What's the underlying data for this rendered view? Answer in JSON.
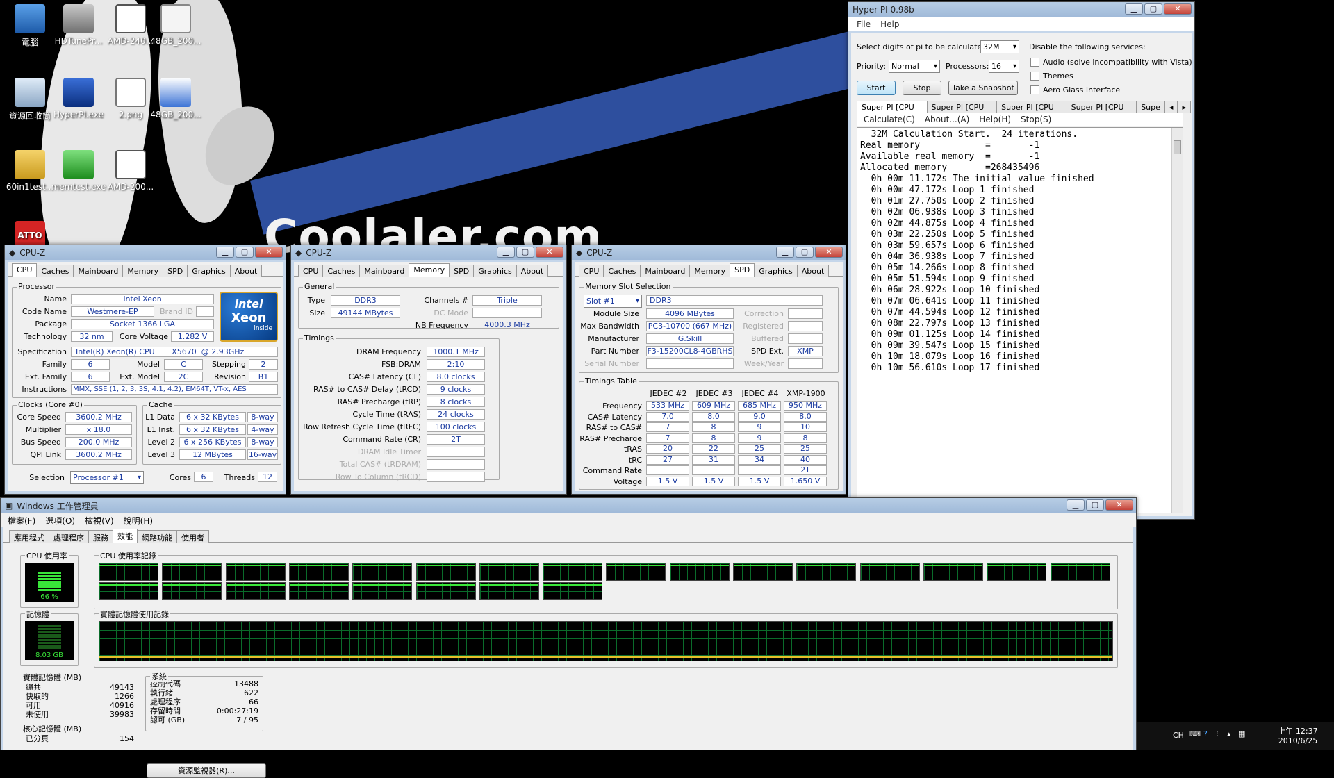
{
  "desktop": {
    "wallpaper_text": "Coolaler.com",
    "icons": [
      {
        "label": "電腦"
      },
      {
        "label": "HDTunePr..."
      },
      {
        "label": "AMD-240..."
      },
      {
        "label": "48GB_200..."
      },
      {
        "label": "資源回收筒"
      },
      {
        "label": "HyperPI.exe"
      },
      {
        "label": "2.png"
      },
      {
        "label": "48GB_200..."
      },
      {
        "label": "60in1test..."
      },
      {
        "label": "memtest.exe"
      },
      {
        "label": "AMD-200..."
      },
      {
        "label": "ATTO"
      },
      {
        "label": ""
      },
      {
        "label": ""
      }
    ]
  },
  "cpuz1": {
    "title": "CPU-Z",
    "tabs": [
      "CPU",
      "Caches",
      "Mainboard",
      "Memory",
      "SPD",
      "Graphics",
      "About"
    ],
    "processor": {
      "group": "Processor",
      "name_l": "Name",
      "name": "Intel Xeon",
      "codename_l": "Code Name",
      "codename": "Westmere-EP",
      "brandid_l": "Brand ID",
      "package_l": "Package",
      "package": "Socket 1366 LGA",
      "tech_l": "Technology",
      "tech": "32 nm",
      "voltage_l": "Core Voltage",
      "voltage": "1.282 V",
      "spec_l": "Specification",
      "spec": "Intel(R) Xeon(R) CPU",
      "spec2": "X5670",
      "spec3": "@ 2.93GHz",
      "family_l": "Family",
      "family": "6",
      "model_l": "Model",
      "model": "C",
      "stepping_l": "Stepping",
      "stepping": "2",
      "extfam_l": "Ext. Family",
      "extfam": "6",
      "extmodel_l": "Ext. Model",
      "extmodel": "2C",
      "rev_l": "Revision",
      "rev": "B1",
      "instr_l": "Instructions",
      "instr": "MMX, SSE (1, 2, 3, 3S, 4.1, 4.2), EM64T, VT-x, AES",
      "logo_brand": "intel",
      "logo_name": "Xeon",
      "logo_sub": "inside"
    },
    "clocks": {
      "group": "Clocks (Core #0)",
      "speed_l": "Core Speed",
      "speed": "3600.2 MHz",
      "mult_l": "Multiplier",
      "mult": "x 18.0",
      "bus_l": "Bus Speed",
      "bus": "200.0 MHz",
      "qpi_l": "QPI Link",
      "qpi": "3600.2 MHz"
    },
    "cache": {
      "group": "Cache",
      "l1d_l": "L1 Data",
      "l1d": "6 x 32 KBytes",
      "l1d_w": "8-way",
      "l1i_l": "L1 Inst.",
      "l1i": "6 x 32 KBytes",
      "l1i_w": "4-way",
      "l2_l": "Level 2",
      "l2": "6 x 256 KBytes",
      "l2_w": "8-way",
      "l3_l": "Level 3",
      "l3": "12 MBytes",
      "l3_w": "16-way"
    },
    "selection_l": "Selection",
    "selection": "Processor #1",
    "cores_l": "Cores",
    "cores": "6",
    "threads_l": "Threads",
    "threads": "12"
  },
  "cpuz2": {
    "title": "CPU-Z",
    "tabs": [
      "CPU",
      "Caches",
      "Mainboard",
      "Memory",
      "SPD",
      "Graphics",
      "About"
    ],
    "general": "General",
    "type_l": "Type",
    "type": "DDR3",
    "channels_l": "Channels #",
    "channels": "Triple",
    "size_l": "Size",
    "size": "49144 MBytes",
    "dcmode_l": "DC Mode",
    "nbfreq_l": "NB Frequency",
    "nbfreq": "4000.3 MHz",
    "timings": "Timings",
    "rows": [
      {
        "l": "DRAM Frequency",
        "v": "1000.1 MHz"
      },
      {
        "l": "FSB:DRAM",
        "v": "2:10"
      },
      {
        "l": "CAS# Latency (CL)",
        "v": "8.0 clocks"
      },
      {
        "l": "RAS# to CAS# Delay (tRCD)",
        "v": "9 clocks"
      },
      {
        "l": "RAS# Precharge (tRP)",
        "v": "8 clocks"
      },
      {
        "l": "Cycle Time (tRAS)",
        "v": "24 clocks"
      },
      {
        "l": "Row Refresh Cycle Time (tRFC)",
        "v": "100 clocks"
      },
      {
        "l": "Command Rate (CR)",
        "v": "2T"
      },
      {
        "l": "DRAM Idle Timer",
        "v": ""
      },
      {
        "l": "Total CAS# (tRDRAM)",
        "v": ""
      },
      {
        "l": "Row To Column (tRCD)",
        "v": ""
      }
    ]
  },
  "cpuz3": {
    "title": "CPU-Z",
    "tabs": [
      "CPU",
      "Caches",
      "Mainboard",
      "Memory",
      "SPD",
      "Graphics",
      "About"
    ],
    "slotgroup": "Memory Slot Selection",
    "slot": "Slot #1",
    "memtype": "DDR3",
    "modsize_l": "Module Size",
    "modsize": "4096 MBytes",
    "correction_l": "Correction",
    "maxbw_l": "Max Bandwidth",
    "maxbw": "PC3-10700 (667 MHz)",
    "registered_l": "Registered",
    "manuf_l": "Manufacturer",
    "manuf": "G.Skill",
    "buffered_l": "Buffered",
    "part_l": "Part Number",
    "part": "F3-15200CL8-4GBRHS",
    "spdext_l": "SPD Ext.",
    "spdext": "XMP",
    "serial_l": "Serial Number",
    "week_l": "Week/Year",
    "ttable": "Timings Table",
    "cols": [
      "JEDEC #2",
      "JEDEC #3",
      "JEDEC #4",
      "XMP-1900"
    ],
    "rows": [
      {
        "l": "Frequency",
        "v": [
          "533 MHz",
          "609 MHz",
          "685 MHz",
          "950 MHz"
        ]
      },
      {
        "l": "CAS# Latency",
        "v": [
          "7.0",
          "8.0",
          "9.0",
          "8.0"
        ]
      },
      {
        "l": "RAS# to CAS#",
        "v": [
          "7",
          "8",
          "9",
          "10"
        ]
      },
      {
        "l": "RAS# Precharge",
        "v": [
          "7",
          "8",
          "9",
          "8"
        ]
      },
      {
        "l": "tRAS",
        "v": [
          "20",
          "22",
          "25",
          "25"
        ]
      },
      {
        "l": "tRC",
        "v": [
          "27",
          "31",
          "34",
          "40"
        ]
      },
      {
        "l": "Command Rate",
        "v": [
          "",
          "",
          "",
          "2T"
        ]
      },
      {
        "l": "Voltage",
        "v": [
          "1.5 V",
          "1.5 V",
          "1.5 V",
          "1.650 V"
        ]
      }
    ]
  },
  "hyperpi": {
    "title": "Hyper PI 0.98b",
    "menu": [
      "File",
      "Help"
    ],
    "digits_l": "Select digits of pi to be calculated:",
    "digits": "32M",
    "priority_l": "Priority:",
    "priority": "Normal",
    "procs_l": "Processors:",
    "procs": "16",
    "disable_l": "Disable the following services:",
    "svc1": "Audio (solve incompatibility with Vista)",
    "svc2": "Themes",
    "svc3": "Aero Glass Interface",
    "start": "Start",
    "stop": "Stop",
    "snapshot": "Take a Snapshot",
    "tabs": [
      "Super PI [CPU #0]",
      "Super PI [CPU #1]",
      "Super PI [CPU #2]",
      "Super PI [CPU #3]",
      "Supe"
    ],
    "submenu": [
      "Calculate(C)",
      "About...(A)",
      "Help(H)",
      "Stop(S)"
    ],
    "log": [
      "  32M Calculation Start.  24 iterations.",
      "Real memory            =       -1",
      "Available real memory  =       -1",
      "Allocated memory       =268435496",
      "  0h 00m 11.172s The initial value finished",
      "  0h 00m 47.172s Loop 1 finished",
      "  0h 01m 27.750s Loop 2 finished",
      "  0h 02m 06.938s Loop 3 finished",
      "  0h 02m 44.875s Loop 4 finished",
      "  0h 03m 22.250s Loop 5 finished",
      "  0h 03m 59.657s Loop 6 finished",
      "  0h 04m 36.938s Loop 7 finished",
      "  0h 05m 14.266s Loop 8 finished",
      "  0h 05m 51.594s Loop 9 finished",
      "  0h 06m 28.922s Loop 10 finished",
      "  0h 07m 06.641s Loop 11 finished",
      "  0h 07m 44.594s Loop 12 finished",
      "  0h 08m 22.797s Loop 13 finished",
      "  0h 09m 01.125s Loop 14 finished",
      "  0h 09m 39.547s Loop 15 finished",
      "  0h 10m 18.079s Loop 16 finished",
      "  0h 10m 56.610s Loop 17 finished"
    ]
  },
  "taskmgr": {
    "title": "Windows 工作管理員",
    "menu": [
      "檔案(F)",
      "選項(O)",
      "檢視(V)",
      "說明(H)"
    ],
    "tabs": [
      "應用程式",
      "處理程序",
      "服務",
      "效能",
      "網路功能",
      "使用者"
    ],
    "cpu_usage_l": "CPU 使用率",
    "cpu_usage": "66 %",
    "cpu_level": 0.66,
    "cpu_hist_l": "CPU 使用率記錄",
    "mem_l": "記憶體",
    "mem": "8.03 GB",
    "mem_hist_l": "實體記憶體使用記錄",
    "phys_l": "實體記憶體 (MB)",
    "phys": [
      {
        "l": "總共",
        "v": "49143"
      },
      {
        "l": "快取的",
        "v": "1266"
      },
      {
        "l": "可用",
        "v": "40916"
      },
      {
        "l": "未使用",
        "v": "39983"
      }
    ],
    "sys_l": "系統",
    "sys": [
      {
        "l": "控制代碼",
        "v": "13488"
      },
      {
        "l": "執行緒",
        "v": "622"
      },
      {
        "l": "處理程序",
        "v": "66"
      },
      {
        "l": "存留時間",
        "v": "0:00:27:19"
      },
      {
        "l": "認可 (GB)",
        "v": "7 / 95"
      }
    ],
    "kern_l": "核心記憶體 (MB)",
    "kern": [
      {
        "l": "已分頁",
        "v": "154"
      }
    ],
    "resmon": "資源監視器(R)..."
  },
  "taskbar": {
    "lang": "CH",
    "time": "上午 12:37",
    "date": "2010/6/25"
  }
}
